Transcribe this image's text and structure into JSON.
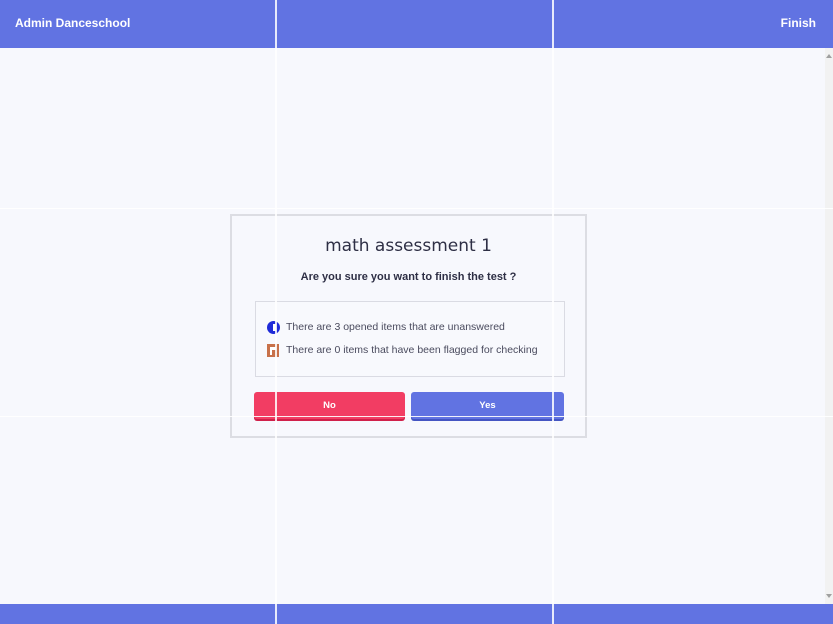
{
  "header": {
    "title": "Admin Danceschool",
    "finish_label": "Finish"
  },
  "dialog": {
    "title": "math assessment 1",
    "question": "Are you sure you want to finish the test ?",
    "info": [
      {
        "icon": "opened-item-icon",
        "text": "There are 3 opened items that are unanswered"
      },
      {
        "icon": "flag-icon",
        "text": "There are 0 items that have been flagged for checking"
      }
    ],
    "no_label": "No",
    "yes_label": "Yes"
  },
  "colors": {
    "brand": "#6173e2",
    "danger": "#f23d63",
    "background": "#f7f8fd",
    "text": "#2e2f45"
  }
}
